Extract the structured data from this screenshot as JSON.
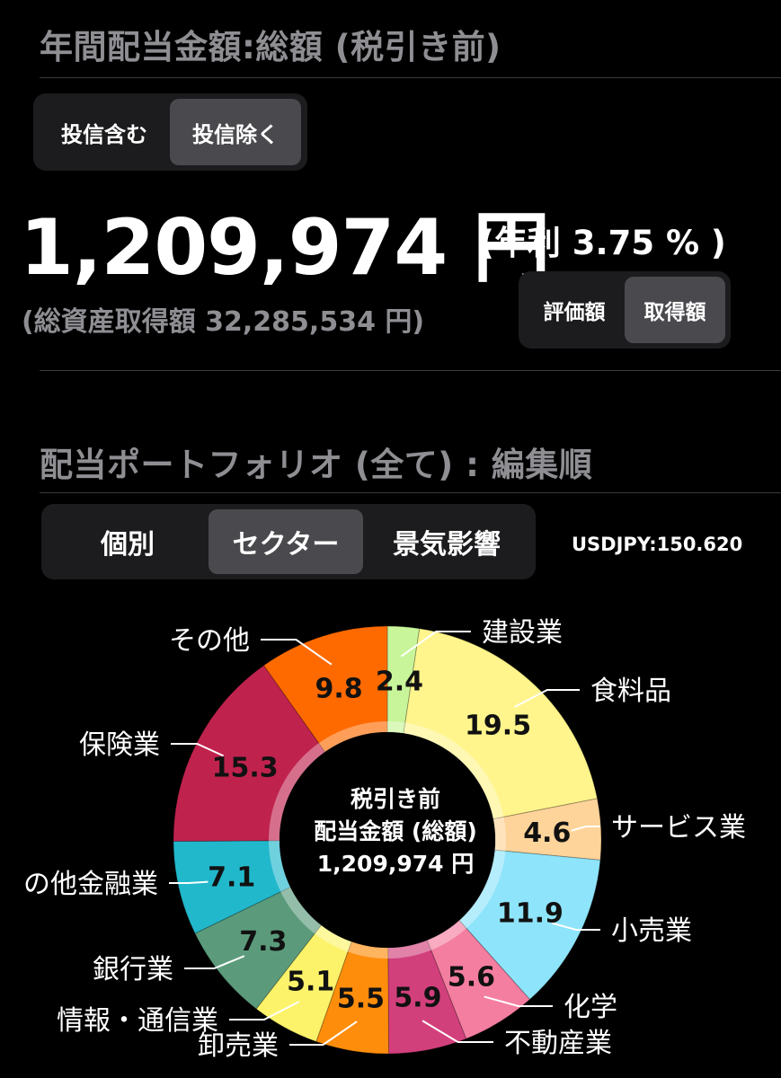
{
  "header": {
    "title": "年間配当金額:総額 (税引き前)"
  },
  "fund_toggle": {
    "options": [
      "投信含む",
      "投信除く"
    ],
    "selected": 1
  },
  "summary": {
    "amount": "1,209,974 円",
    "yield": "(年利 3.75 % )",
    "cost_basis": "(総資産取得額 32,285,534 円)"
  },
  "valuation_toggle": {
    "options": [
      "評価額",
      "取得額"
    ],
    "selected": 1
  },
  "portfolio": {
    "title": "配当ポートフォリオ (全て) : 編集順"
  },
  "view_toggle": {
    "options": [
      "個別",
      "セクター",
      "景気影響"
    ],
    "selected": 1
  },
  "fx_rate": "USDJPY:150.620",
  "chart_center": {
    "line1": "税引き前",
    "line2": "配当金額 (総額)",
    "line3": "1,209,974 円"
  },
  "colors": {
    "background": "#000000",
    "segment_bg": "#1c1c1e",
    "segment_active": "#4a4a4e",
    "heading": "#8e8e93"
  },
  "chart_data": {
    "type": "pie",
    "title": "",
    "unit": "%",
    "slices": [
      {
        "label": "建設業",
        "value": 2.4,
        "color": "#c8f59a"
      },
      {
        "label": "食料品",
        "value": 19.5,
        "color": "#fff58c"
      },
      {
        "label": "サービス業",
        "value": 4.6,
        "color": "#ffd49a"
      },
      {
        "label": "小売業",
        "value": 11.9,
        "color": "#8ee4fb"
      },
      {
        "label": "化学",
        "value": 5.6,
        "color": "#f47ea0"
      },
      {
        "label": "不動産業",
        "value": 5.9,
        "color": "#d2407c"
      },
      {
        "label": "卸売業",
        "value": 5.5,
        "color": "#ff8d0c"
      },
      {
        "label": "情報・通信業",
        "value": 5.1,
        "color": "#fcf36a"
      },
      {
        "label": "銀行業",
        "value": 7.3,
        "color": "#5b9b7b"
      },
      {
        "label": "の他金融業",
        "value": 7.1,
        "color": "#22b8cc"
      },
      {
        "label": "保険業",
        "value": 15.3,
        "color": "#c0224e"
      },
      {
        "label": "その他",
        "value": 9.8,
        "color": "#ff6a00"
      }
    ]
  }
}
